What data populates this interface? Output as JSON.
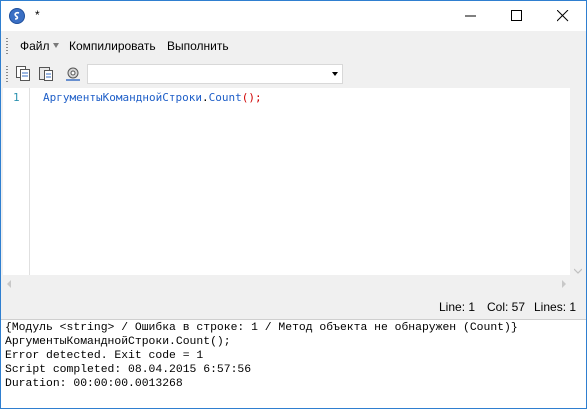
{
  "window": {
    "title": "*"
  },
  "menu": {
    "file": "Файл",
    "compile": "Компилировать",
    "run": "Выполнить"
  },
  "toolbar": {
    "icons": [
      "copy-code-icon",
      "paste-code-icon",
      "debug-settings-icon"
    ],
    "combo_value": ""
  },
  "editor": {
    "line_number": "1",
    "code": {
      "object": "АргументыКоманднойСтроки",
      "dot": ".",
      "method": "Count",
      "parens": "()",
      "semicolon": ";"
    }
  },
  "status": {
    "line": "Line:  1",
    "col": "Col:  57",
    "lines": "Lines:  1"
  },
  "output": {
    "lines": [
      "{Модуль <string> / Ошибка в строке: 1 / Метод объекта не обнаружен (Count)}",
      "АргументыКоманднойСтроки.Count();",
      "Error detected. Exit code = 1",
      "Script completed: 08.04.2015 6:57:56",
      "Duration: 00:00:00.0013268"
    ]
  },
  "colors": {
    "accent": "#2f7fd0",
    "keyword": "#1f5fc8",
    "error": "#d00000",
    "line_number": "#2b91af"
  }
}
